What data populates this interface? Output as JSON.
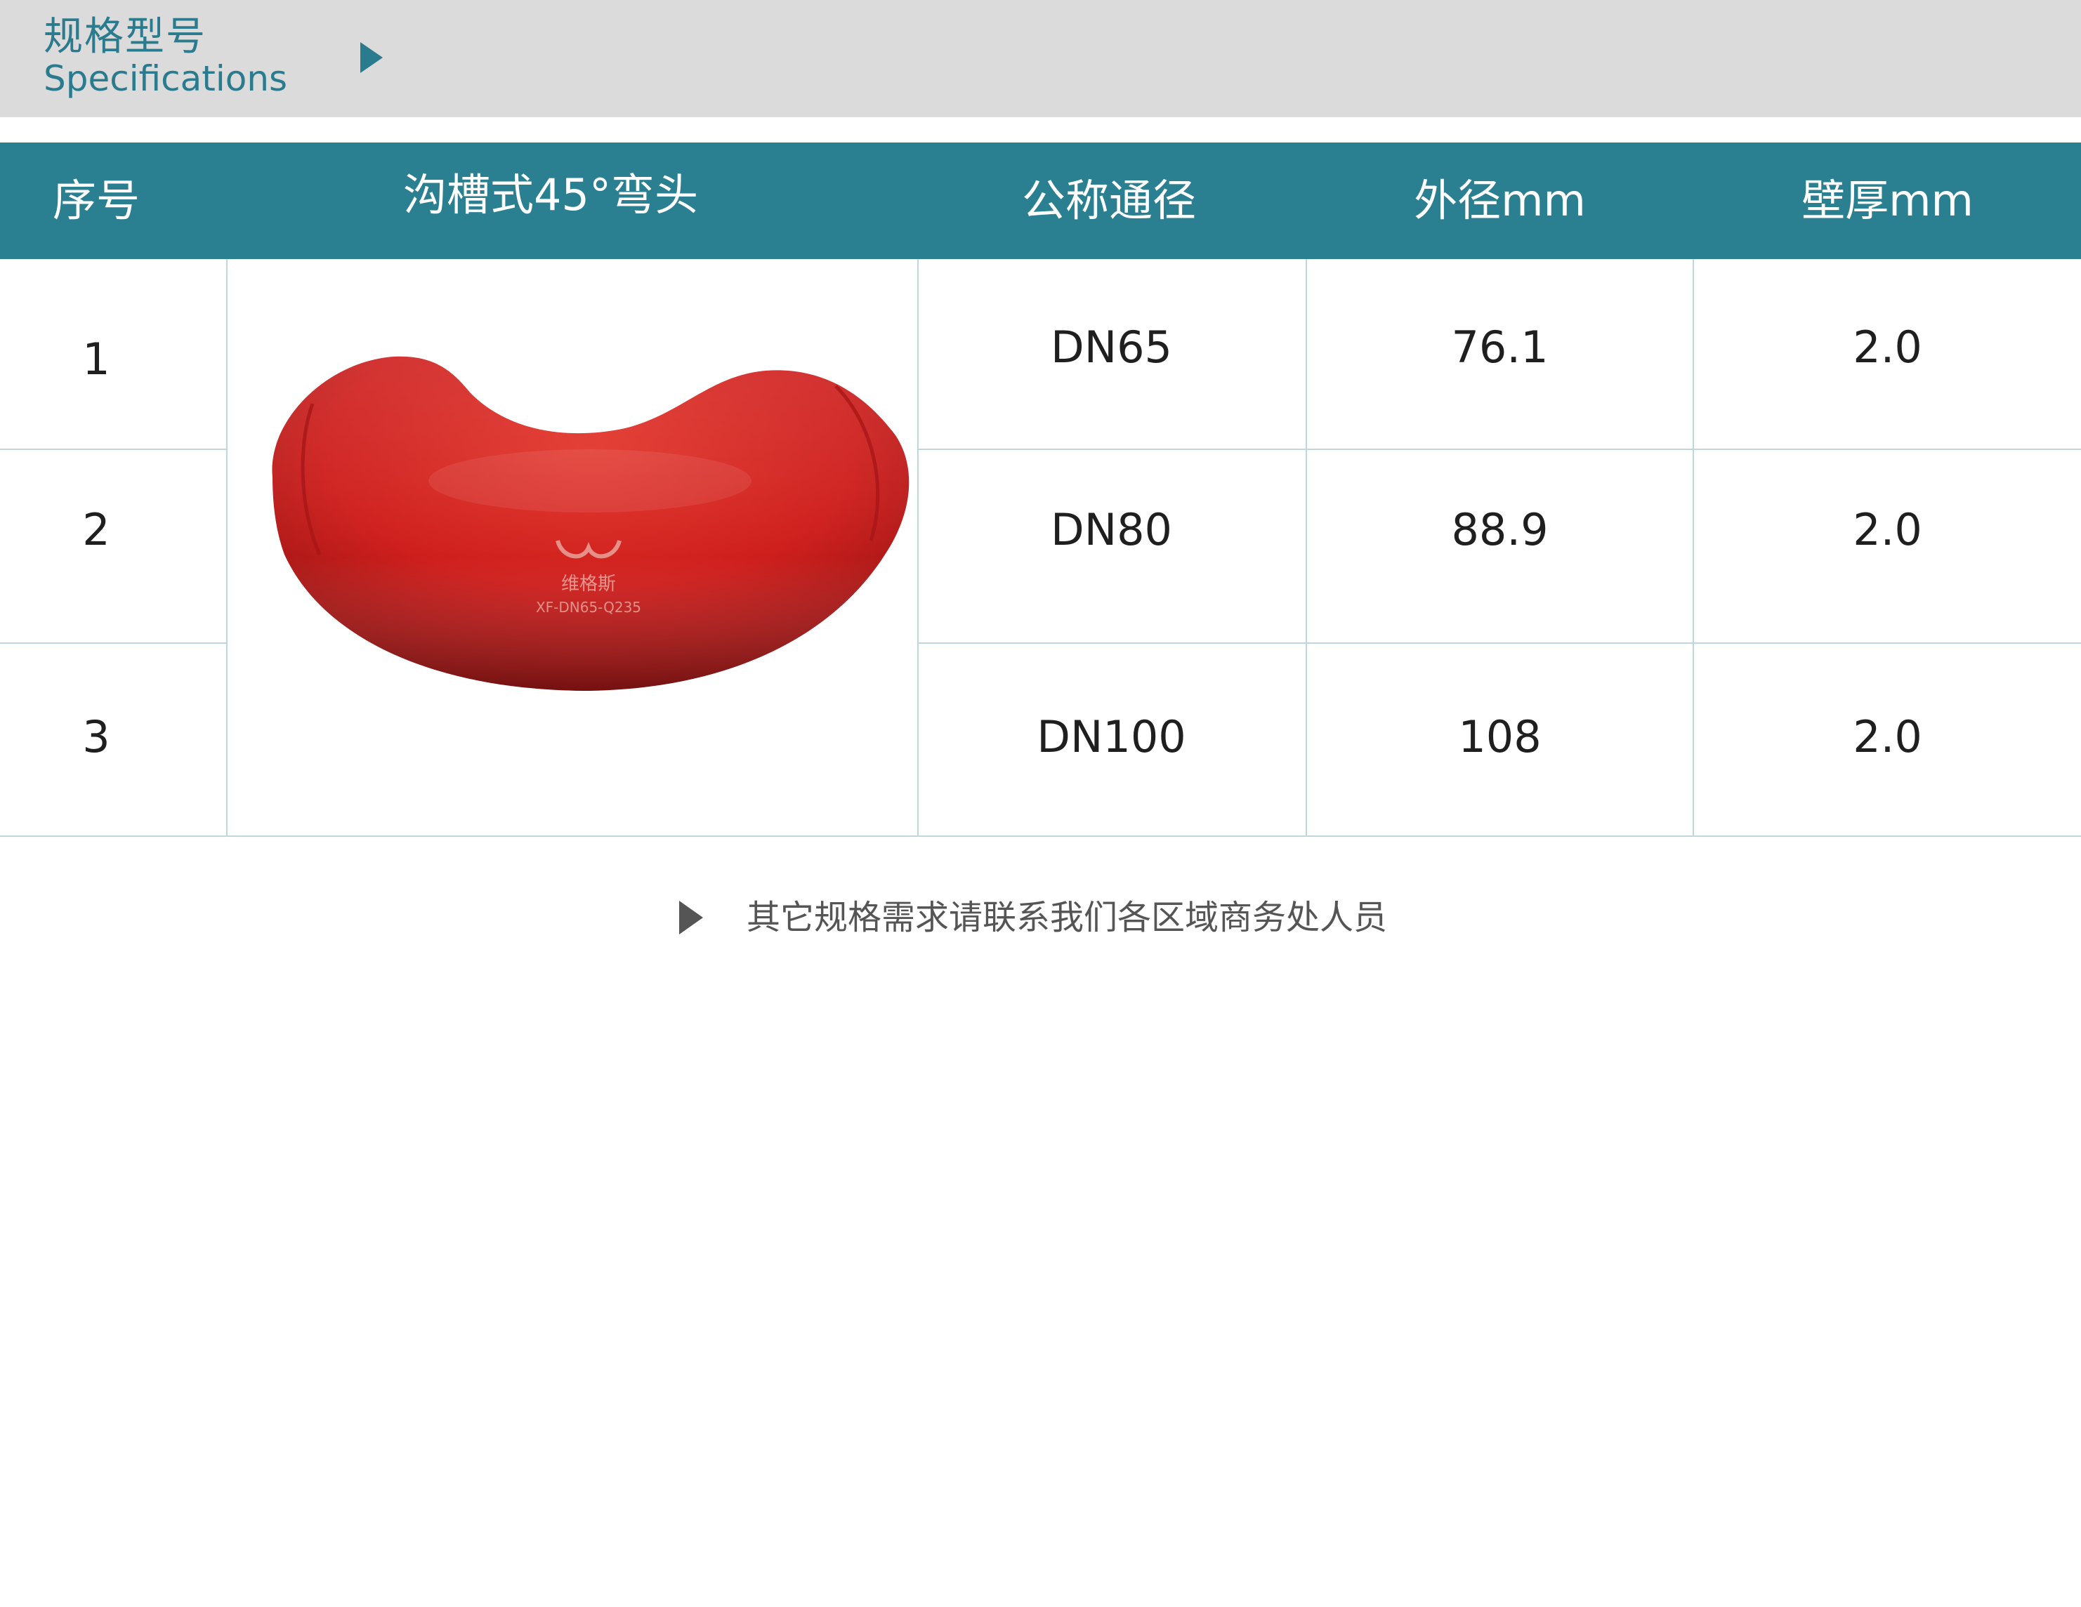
{
  "header": {
    "title_cn": "规格型号",
    "title_en": "Specifications",
    "arrow_icon": "play-triangle-icon"
  },
  "table": {
    "columns": [
      "序号",
      "沟槽式45°弯头",
      "公称通径",
      "外径mm",
      "壁厚mm"
    ],
    "rows": [
      {
        "index": "1",
        "nominal": "DN65",
        "outer": "76.1",
        "wall": "2.0"
      },
      {
        "index": "2",
        "nominal": "DN80",
        "outer": "88.9",
        "wall": "2.0"
      },
      {
        "index": "3",
        "nominal": "DN100",
        "outer": "108",
        "wall": "2.0"
      }
    ]
  },
  "product_image": {
    "subject": "red grooved 45° elbow",
    "logo_text": "维格斯",
    "stamp_text": "XF-DN65-Q235"
  },
  "note": {
    "text": "其它规格需求请联系我们各区域商务处人员",
    "arrow_icon": "play-triangle-icon"
  },
  "colors": {
    "header_band": "#dbdbdb",
    "accent_teal": "#2a7f90",
    "product_red": "#d4221f",
    "grid_line": "#bfd6da"
  }
}
